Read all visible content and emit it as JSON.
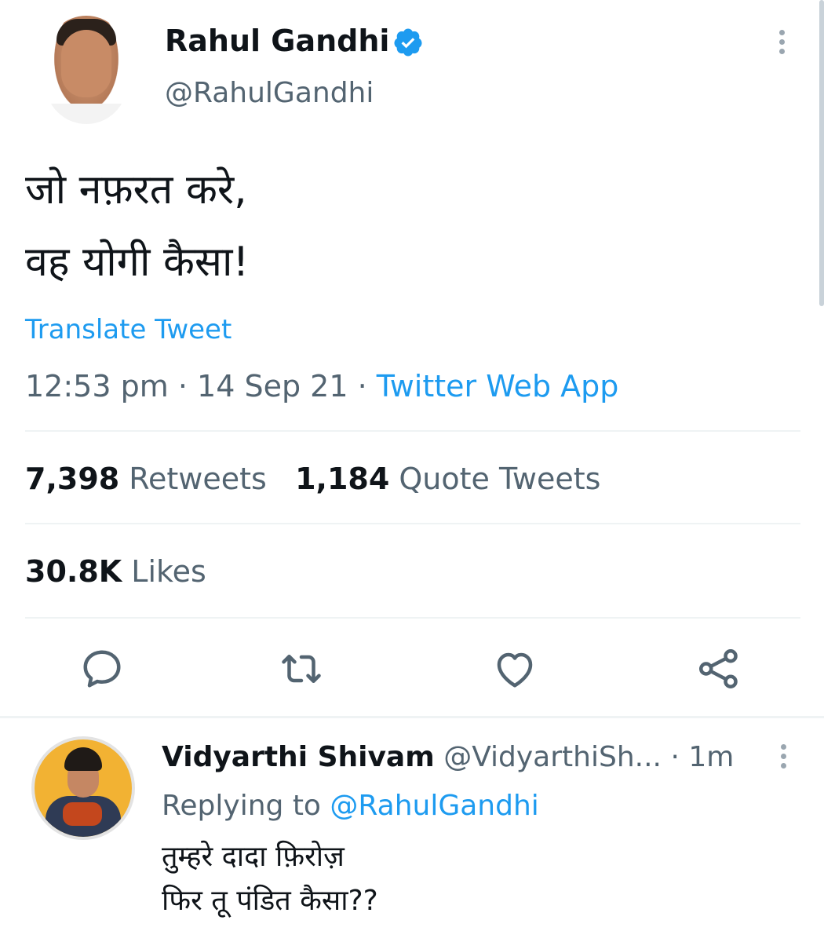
{
  "tweet": {
    "author_name": "Rahul Gandhi",
    "author_handle": "@RahulGandhi",
    "verified": true,
    "text": "जो नफ़रत करे,\nवह योगी कैसा!",
    "translate_label": "Translate Tweet",
    "time": "12:53 pm",
    "date": "14 Sep 21",
    "separator": "·",
    "source": "Twitter Web App",
    "retweets_count": "7,398",
    "retweets_label": "Retweets",
    "quote_count": "1,184",
    "quote_label": "Quote Tweets",
    "likes_count": "30.8K",
    "likes_label": "Likes",
    "actions": [
      "reply-icon",
      "retweet-icon",
      "like-icon",
      "share-icon"
    ]
  },
  "reply": {
    "author_name": "Vidyarthi Shivam",
    "author_handle": "@VidyarthiSh...",
    "separator": "·",
    "time": "1m",
    "replying_prefix": "Replying to",
    "replying_to": "@RahulGandhi",
    "text": "तुम्हरे दादा फ़िरोज़\nफिर तू पंडित कैसा??"
  },
  "colors": {
    "link": "#1d9bf0",
    "secondary_text": "#536471",
    "primary_text": "#0f1419",
    "divider": "#eff3f4"
  }
}
